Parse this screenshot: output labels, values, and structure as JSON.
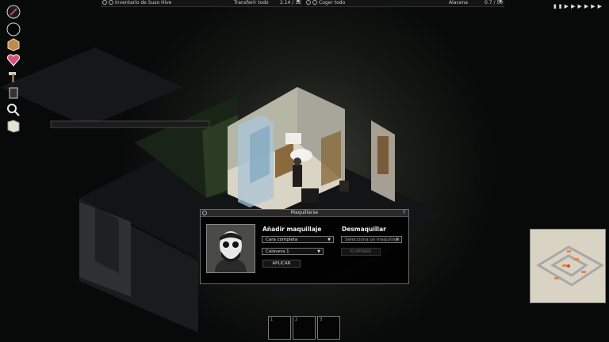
{
  "inventory_bar": {
    "title": "Inventario de Suso Hive",
    "transfer_all": "Transferir todo",
    "weight": "2.14 / 12"
  },
  "loot_bar": {
    "take_all": "Coger todo",
    "container": "Alacena",
    "weight": "0.7 / 50"
  },
  "sidebar": {
    "items": [
      {
        "icon": "health-icon"
      },
      {
        "icon": "empty-slot-icon"
      },
      {
        "icon": "crafting-box-icon"
      },
      {
        "icon": "heart-icon"
      },
      {
        "icon": "hammer-icon"
      },
      {
        "icon": "trash-can-icon"
      },
      {
        "icon": "magnifier-icon"
      },
      {
        "icon": "map-icon"
      }
    ]
  },
  "speed_controls": {
    "icons": [
      "pause-icon",
      "play-icon",
      "fast-forward-icon",
      "faster-icon"
    ]
  },
  "makeup_window": {
    "title": "Maquillarse",
    "help": "?",
    "add_heading": "Añadir maquillaje",
    "category_value": "Cara completa",
    "style_value": "Calavera 1",
    "apply_label": "APLICAR",
    "remove_heading": "Desmaquillar",
    "remove_placeholder": "Selecciona un maquillaje",
    "remove_button": "ELIMINAR"
  },
  "hotbar": {
    "slots": [
      "1",
      "2",
      "3"
    ]
  },
  "colors": {
    "accent": "#c9a36b",
    "window_bg": "#000000",
    "border": "#6a6a6a"
  }
}
